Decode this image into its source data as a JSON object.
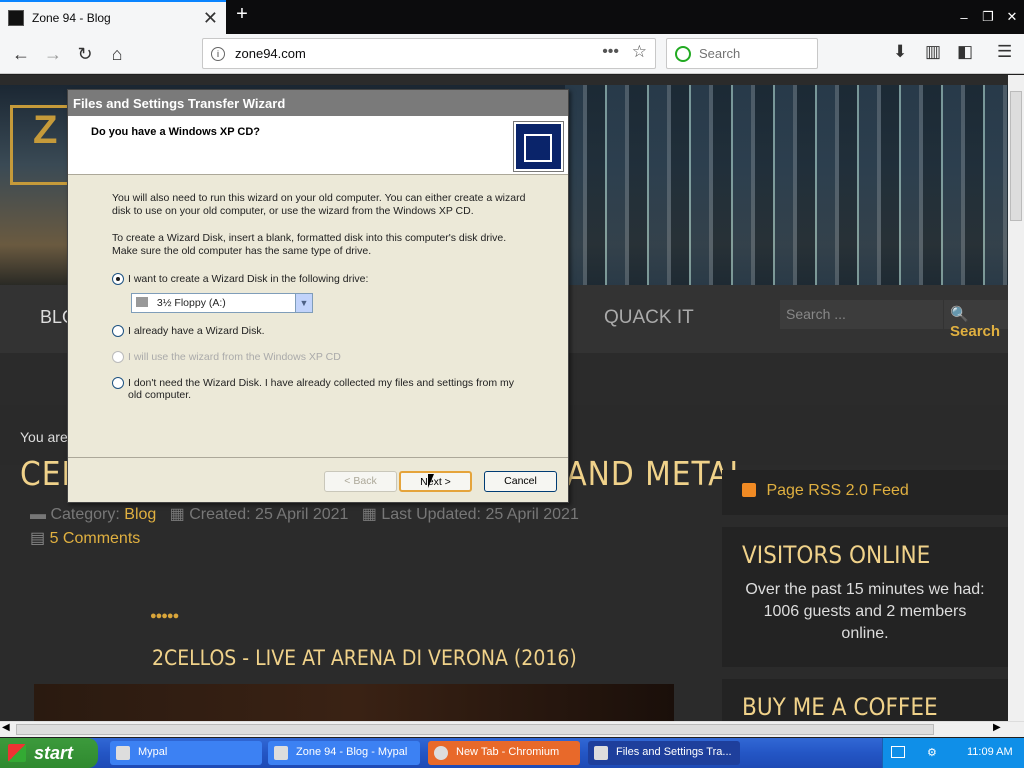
{
  "browser": {
    "tab_title": "Zone 94 - Blog",
    "tab_close": "✕",
    "new_tab": "+",
    "url": "zone94.com",
    "search_placeholder": "Search",
    "win_min": "‒",
    "win_max": "❐",
    "win_close": "✕"
  },
  "site": {
    "logo_letter": "Z",
    "menu_blog": "BLO",
    "menu_quack": "QUACK IT",
    "search_placeholder": "Search ...",
    "search_button": "Search",
    "breadcrumb": "You are",
    "article_title": "CELLO CROSSOVER MUSIC - ROCK AND METAL",
    "meta_category_label": "Category:",
    "meta_category": "Blog",
    "meta_created": "Created: 25 April 2021",
    "meta_updated": "Last Updated: 25 April 2021",
    "comments": "5 Comments",
    "stars": "●●●●●",
    "video_title": "2CELLOS - LIVE AT ARENA DI VERONA (2016)",
    "rss": "Page RSS 2.0 Feed",
    "visitors_heading": "VISITORS ONLINE",
    "visitors_text": "Over the past 15 minutes we had: 1006 guests and 2 members online.",
    "coffee_heading": "BUY ME A COFFEE"
  },
  "dialog": {
    "title": "Files and Settings Transfer Wizard",
    "question": "Do you have a Windows XP CD?",
    "para1": "You will also need to run this wizard on your old computer. You can either create a wizard disk to use on your old computer, or use the wizard from the Windows XP CD.",
    "para2": "To create a Wizard Disk, insert a blank, formatted disk into this computer's disk drive. Make sure the old computer has the same type of drive.",
    "opt1": "I want to create a Wizard Disk in the following drive:",
    "drive": "3½ Floppy (A:)",
    "opt2": "I already have a Wizard Disk.",
    "opt3": "I will use the wizard from the Windows XP CD",
    "opt4": "I don't need the Wizard Disk. I have already collected my files and settings from my old computer.",
    "back": "< Back",
    "next": "Next >",
    "cancel": "Cancel"
  },
  "taskbar": {
    "start": "start",
    "tasks": [
      "Mypal",
      "Zone 94 - Blog - Mypal",
      "New Tab - Chromium",
      "Files and Settings Tra..."
    ],
    "clock": "11:09 AM"
  }
}
